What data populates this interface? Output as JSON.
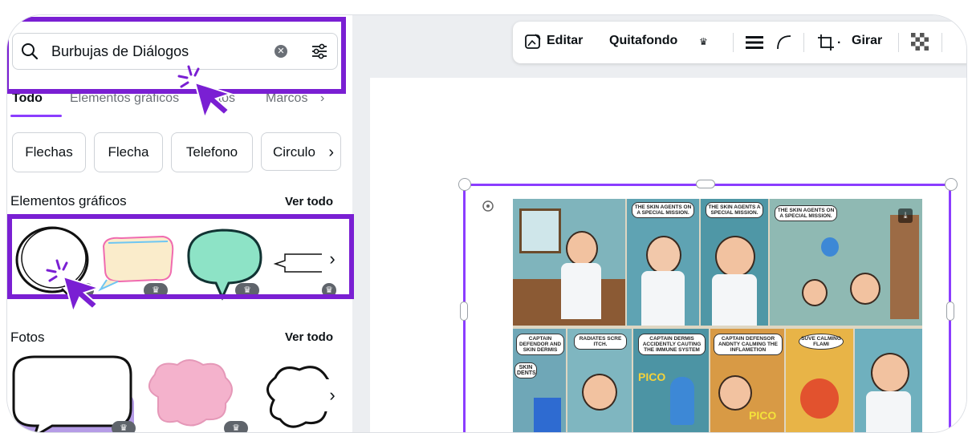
{
  "search": {
    "query": "Burbujas de Diálogos"
  },
  "tabs": [
    "Todo",
    "Elementos gráficos",
    "Fotos",
    "Marcos"
  ],
  "chips": [
    "Flechas",
    "Flecha",
    "Telefono",
    "Circulo"
  ],
  "sections": {
    "graphics": {
      "title": "Elementos gráficos",
      "see_all": "Ver todo"
    },
    "photos": {
      "title": "Fotos",
      "see_all": "Ver todo"
    }
  },
  "toolbar": {
    "edit": "Editar",
    "bg_remover": "Quitafondo",
    "rotate": "Girar"
  },
  "comic": {
    "bubbles": [
      "THE SKIN AGENTS ON A SPECIAL MISSION.",
      "THE SKIN AGENTS A SPECIAL MISSION.",
      "THE SKIN AGENTS ON A SPECIAL MISSION.",
      "CAPTAIN DEFENDOR AND SKIN DERMIS",
      "RADIATES SCRE ITCH.",
      "CAPTAIN DERMIS ACCIDENTLY CAUTING THE IMMUNE SYSTEM",
      "CAPTAIN DEFENSOR ANDNTY CALMING THE INFLAMETION",
      "SUVE CALMING FLAMI"
    ],
    "labels": [
      "SKIN DENTS",
      "PICO",
      "PICO"
    ]
  },
  "colors": {
    "accent": "#8b3dff",
    "highlight": "#7a1fd3"
  }
}
